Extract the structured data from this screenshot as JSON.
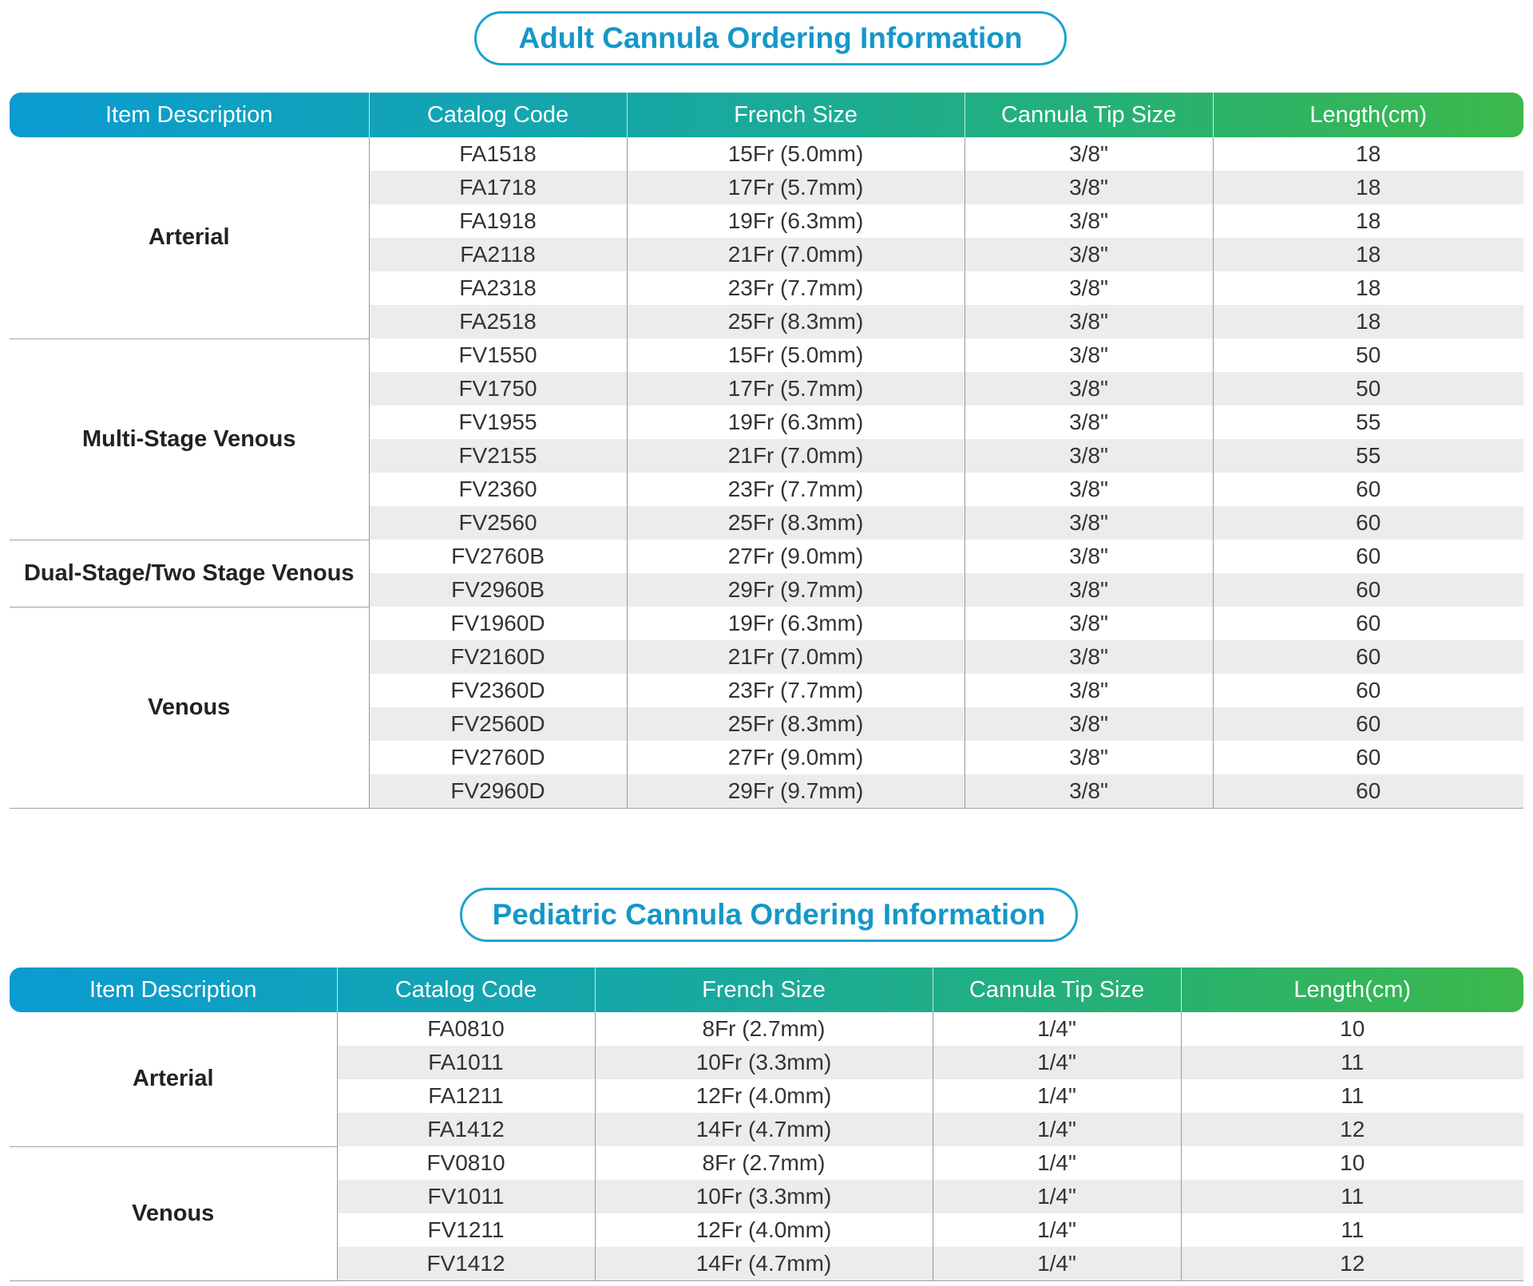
{
  "adult": {
    "title": "Adult  Cannula Ordering Information",
    "headers": [
      "Item Description",
      "Catalog Code",
      "French Size",
      "Cannula Tip Size",
      "Length(cm)"
    ],
    "groups": [
      {
        "name": "Arterial",
        "rows": [
          [
            "FA1518",
            "15Fr (5.0mm)",
            "3/8\"",
            "18"
          ],
          [
            "FA1718",
            "17Fr (5.7mm)",
            "3/8\"",
            "18"
          ],
          [
            "FA1918",
            "19Fr (6.3mm)",
            "3/8\"",
            "18"
          ],
          [
            "FA2118",
            "21Fr (7.0mm)",
            "3/8\"",
            "18"
          ],
          [
            "FA2318",
            "23Fr (7.7mm)",
            "3/8\"",
            "18"
          ],
          [
            "FA2518",
            "25Fr (8.3mm)",
            "3/8\"",
            "18"
          ]
        ]
      },
      {
        "name": "Multi-Stage Venous",
        "rows": [
          [
            "FV1550",
            "15Fr (5.0mm)",
            "3/8\"",
            "50"
          ],
          [
            "FV1750",
            "17Fr (5.7mm)",
            "3/8\"",
            "50"
          ],
          [
            "FV1955",
            "19Fr (6.3mm)",
            "3/8\"",
            "55"
          ],
          [
            "FV2155",
            "21Fr (7.0mm)",
            "3/8\"",
            "55"
          ],
          [
            "FV2360",
            "23Fr (7.7mm)",
            "3/8\"",
            "60"
          ],
          [
            "FV2560",
            "25Fr (8.3mm)",
            "3/8\"",
            "60"
          ]
        ]
      },
      {
        "name": "Dual-Stage/Two Stage Venous",
        "rows": [
          [
            "FV2760B",
            "27Fr (9.0mm)",
            "3/8\"",
            "60"
          ],
          [
            "FV2960B",
            "29Fr (9.7mm)",
            "3/8\"",
            "60"
          ]
        ]
      },
      {
        "name": "Venous",
        "rows": [
          [
            "FV1960D",
            "19Fr (6.3mm)",
            "3/8\"",
            "60"
          ],
          [
            "FV2160D",
            "21Fr (7.0mm)",
            "3/8\"",
            "60"
          ],
          [
            "FV2360D",
            "23Fr (7.7mm)",
            "3/8\"",
            "60"
          ],
          [
            "FV2560D",
            "25Fr (8.3mm)",
            "3/8\"",
            "60"
          ],
          [
            "FV2760D",
            "27Fr (9.0mm)",
            "3/8\"",
            "60"
          ],
          [
            "FV2960D",
            "29Fr (9.7mm)",
            "3/8\"",
            "60"
          ]
        ]
      }
    ]
  },
  "pediatric": {
    "title": "Pediatric Cannula Ordering Information",
    "headers": [
      "Item Description",
      "Catalog Code",
      "French Size",
      "Cannula Tip Size",
      "Length(cm)"
    ],
    "groups": [
      {
        "name": "Arterial",
        "rows": [
          [
            "FA0810",
            "8Fr (2.7mm)",
            "1/4\"",
            "10"
          ],
          [
            "FA1011",
            "10Fr (3.3mm)",
            "1/4\"",
            "11"
          ],
          [
            "FA1211",
            "12Fr (4.0mm)",
            "1/4\"",
            "11"
          ],
          [
            "FA1412",
            "14Fr (4.7mm)",
            "1/4\"",
            "12"
          ]
        ]
      },
      {
        "name": "Venous",
        "rows": [
          [
            "FV0810",
            "8Fr (2.7mm)",
            "1/4\"",
            "10"
          ],
          [
            "FV1011",
            "10Fr (3.3mm)",
            "1/4\"",
            "11"
          ],
          [
            "FV1211",
            "12Fr (4.0mm)",
            "1/4\"",
            "11"
          ],
          [
            "FV1412",
            "14Fr (4.7mm)",
            "1/4\"",
            "12"
          ]
        ]
      }
    ]
  }
}
